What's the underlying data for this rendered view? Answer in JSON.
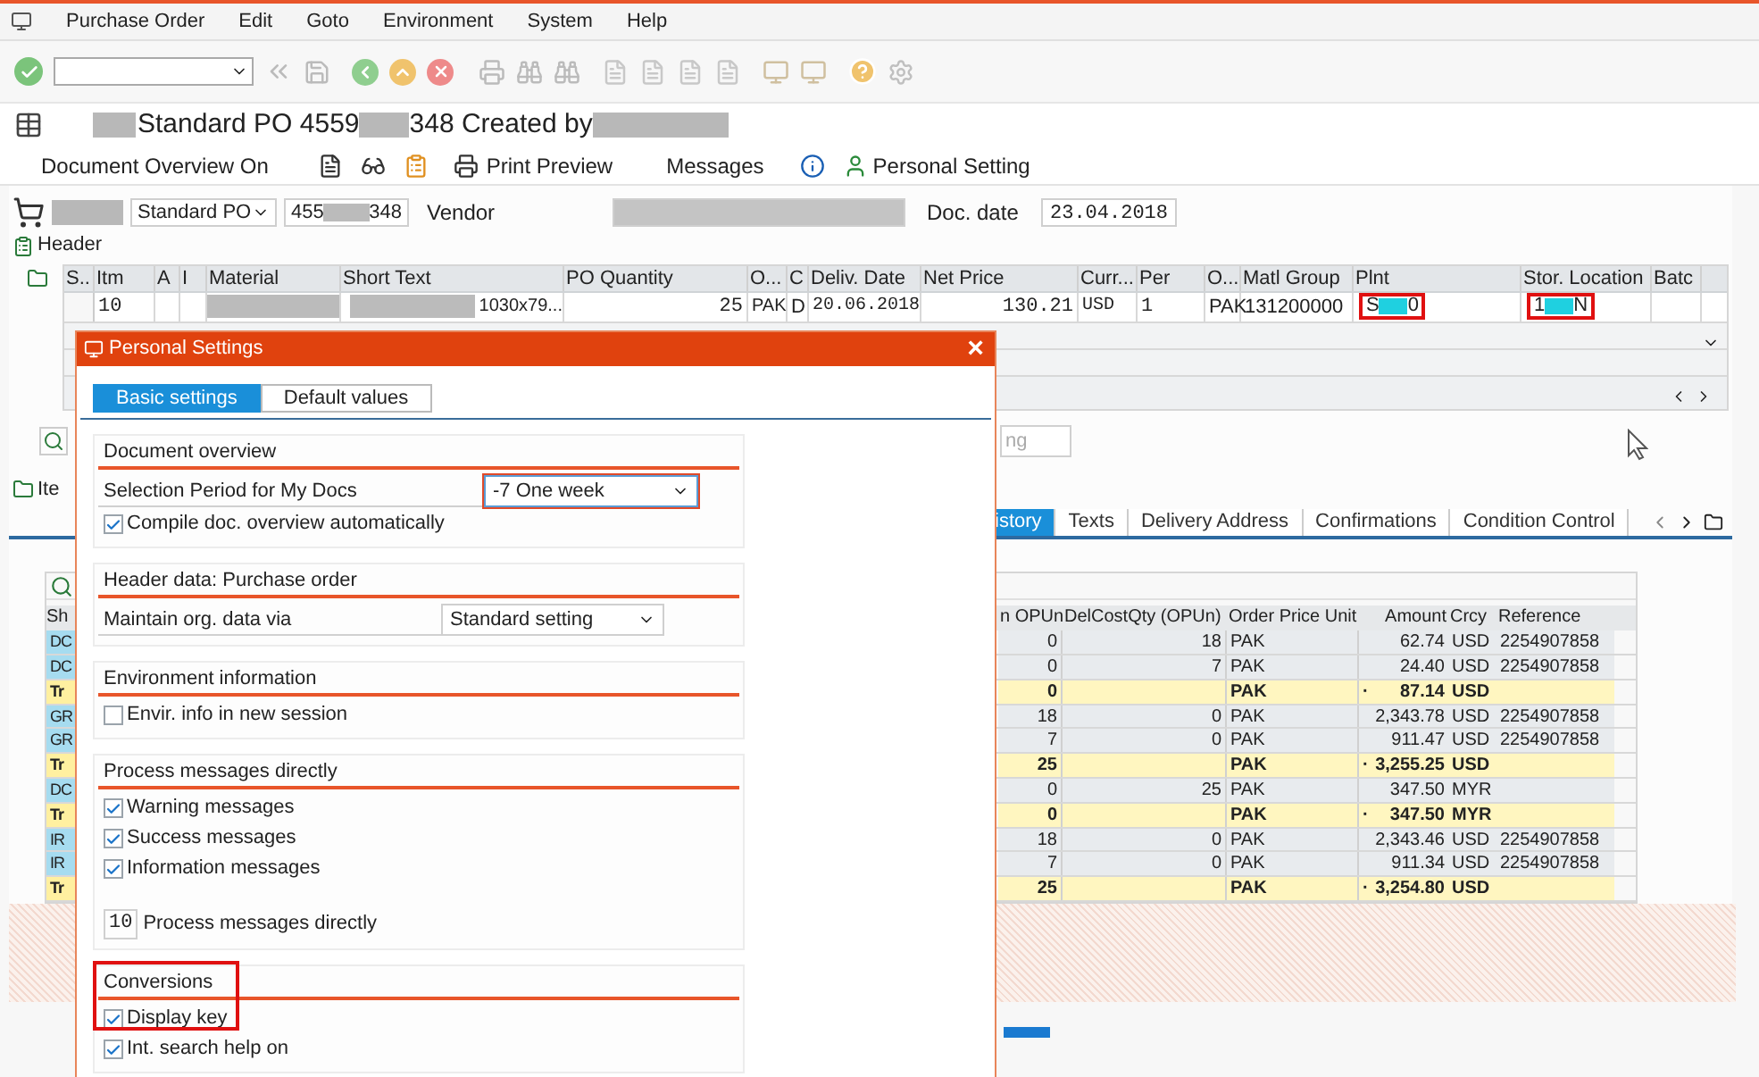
{
  "menu": [
    {
      "label": "Purchase Order"
    },
    {
      "label": "Edit"
    },
    {
      "label": "Goto"
    },
    {
      "label": "Environment"
    },
    {
      "label": "System"
    },
    {
      "label": "Help"
    }
  ],
  "title": {
    "start": "Standard PO 4559",
    "end": "348 Created by"
  },
  "app_toolbar": {
    "overview": "Document Overview On",
    "print": "Print Preview",
    "messages": "Messages",
    "personal": "Personal Setting"
  },
  "header_row": {
    "doc_type": "Standard PO",
    "po_start": "455",
    "po_end": "348",
    "vendor_label": "Vendor",
    "date_label": "Doc. date",
    "date": "23.04.2018"
  },
  "header_section": "Header",
  "items_table": {
    "columns": [
      "S..",
      "Itm",
      "A",
      "I",
      "Material",
      "Short Text",
      "PO Quantity",
      "O...",
      "C",
      "Deliv. Date",
      "Net Price",
      "Curr...",
      "Per",
      "O...",
      "Matl Group",
      "Plnt",
      "Stor. Location",
      "Batc"
    ],
    "rows": [
      {
        "itm": "10",
        "short_text": "1030x79...",
        "qty": "25",
        "unit": "PAK",
        "cat": "D",
        "date": "20.06.2018",
        "price": "130.21",
        "curr": "USD",
        "per": "1",
        "order_unit": "PAK",
        "matl_group": "131200000",
        "plant": {
          "start": "S",
          "end": "0",
          "highlighted": true
        },
        "storage": {
          "start": "1",
          "end": "N",
          "highlighted": true
        }
      }
    ]
  },
  "partial_button": "ng",
  "item_section": "Ite",
  "item_tabs": [
    {
      "label": "istory",
      "selected": true
    },
    {
      "label": "Texts",
      "selected": false
    },
    {
      "label": "Delivery Address",
      "selected": false
    },
    {
      "label": "Confirmations",
      "selected": false
    },
    {
      "label": "Condition Control",
      "selected": false
    }
  ],
  "history_table": {
    "columns": [
      "Sh",
      "n OPUn",
      "DelCostQty (OPUn)",
      "Order Price Unit",
      "Amount",
      "Crcy",
      "Reference"
    ],
    "rows": [
      {
        "kind": "item",
        "type": "DC",
        "qty": "0",
        "delcost": "18",
        "unit": "PAK",
        "amount": "62.74",
        "crcy": "USD",
        "ref": "2254907858"
      },
      {
        "kind": "item",
        "type": "DC",
        "qty": "0",
        "delcost": "7",
        "unit": "PAK",
        "amount": "24.40",
        "crcy": "USD",
        "ref": "2254907858"
      },
      {
        "kind": "total",
        "type": "Tr",
        "qty": "0",
        "unit": "PAK",
        "mark": "·",
        "amount": "87.14",
        "crcy": "USD"
      },
      {
        "kind": "item",
        "type": "GR",
        "qty": "18",
        "delcost": "0",
        "unit": "PAK",
        "amount": "2,343.78",
        "crcy": "USD",
        "ref": "2254907858"
      },
      {
        "kind": "item",
        "type": "GR",
        "qty": "7",
        "delcost": "0",
        "unit": "PAK",
        "amount": "911.47",
        "crcy": "USD",
        "ref": "2254907858"
      },
      {
        "kind": "total",
        "type": "Tr",
        "qty": "25",
        "unit": "PAK",
        "mark": "·",
        "amount": "3,255.25",
        "crcy": "USD"
      },
      {
        "kind": "item",
        "type": "DC",
        "qty": "0",
        "delcost": "25",
        "unit": "PAK",
        "amount": "347.50",
        "crcy": "MYR"
      },
      {
        "kind": "total",
        "type": "Tr",
        "qty": "0",
        "unit": "PAK",
        "mark": "·",
        "amount": "347.50",
        "crcy": "MYR"
      },
      {
        "kind": "item",
        "type": "IR",
        "qty": "18",
        "delcost": "0",
        "unit": "PAK",
        "amount": "2,343.46",
        "crcy": "USD",
        "ref": "2254907858"
      },
      {
        "kind": "item",
        "type": "IR",
        "qty": "7",
        "delcost": "0",
        "unit": "PAK",
        "amount": "911.34",
        "crcy": "USD",
        "ref": "2254907858"
      },
      {
        "kind": "total",
        "type": "Tr",
        "qty": "25",
        "unit": "PAK",
        "mark": "·",
        "amount": "3,254.80",
        "crcy": "USD"
      }
    ]
  },
  "dialog": {
    "title": "Personal Settings",
    "close": "×",
    "tabs": [
      {
        "label": "Basic settings",
        "selected": true
      },
      {
        "label": "Default values",
        "selected": false
      }
    ],
    "groups": [
      {
        "title": "Document overview",
        "highlighted": false,
        "rows": [
          {
            "kind": "select",
            "label": "Selection Period for My Docs",
            "value": "-7 One week",
            "focused": true
          },
          {
            "kind": "checkbox",
            "label": "Compile doc. overview automatically",
            "checked": true
          }
        ]
      },
      {
        "title": "Header data: Purchase order",
        "highlighted": false,
        "rows": [
          {
            "kind": "select",
            "label": "Maintain org. data via",
            "value": "Standard setting",
            "focused": false
          }
        ]
      },
      {
        "title": "Environment information",
        "highlighted": false,
        "rows": [
          {
            "kind": "checkbox",
            "label": "Envir. info in new session",
            "checked": false
          }
        ]
      },
      {
        "title": "Process messages directly",
        "highlighted": false,
        "rows": [
          {
            "kind": "checkbox",
            "label": "Warning messages",
            "checked": true
          },
          {
            "kind": "checkbox",
            "label": "Success messages",
            "checked": true
          },
          {
            "kind": "checkbox",
            "label": "Information messages",
            "checked": true
          },
          {
            "kind": "number",
            "value": "10",
            "label": "Process messages directly"
          }
        ]
      },
      {
        "title": "Conversions",
        "highlighted": true,
        "rows": [
          {
            "kind": "checkbox",
            "label": "Display key",
            "checked": true
          },
          {
            "kind": "checkbox",
            "label": "Int. search help on",
            "checked": true
          }
        ]
      }
    ]
  }
}
